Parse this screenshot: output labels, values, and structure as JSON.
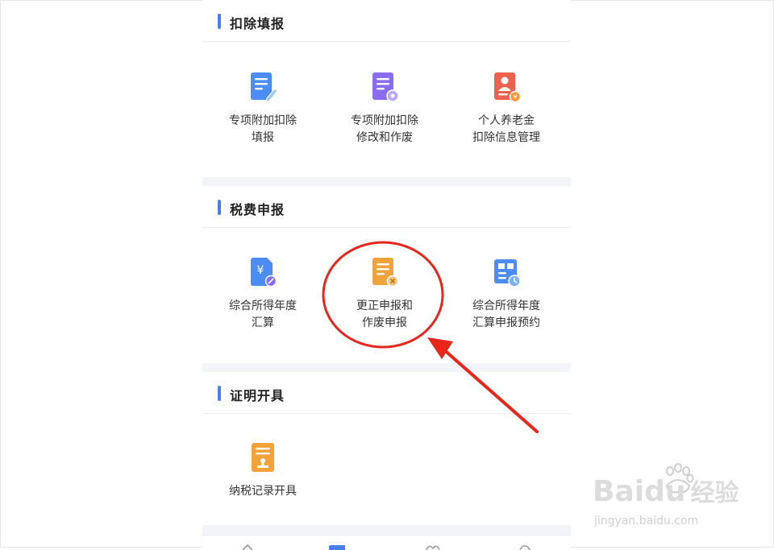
{
  "sections": [
    {
      "title": "扣除填报",
      "items": [
        {
          "line1": "专项附加扣除",
          "line2": "填报",
          "icon": "document-edit-icon",
          "color": "#4d8cf5"
        },
        {
          "line1": "专项附加扣除",
          "line2": "修改和作废",
          "icon": "document-settings-icon",
          "color": "#8a6cf0"
        },
        {
          "line1": "个人养老金",
          "line2": "扣除信息管理",
          "icon": "pension-card-icon",
          "color": "#f0604f"
        }
      ]
    },
    {
      "title": "税费申报",
      "items": [
        {
          "line1": "综合所得年度",
          "line2": "汇算",
          "icon": "tax-yuan-document-icon",
          "color": "#4d8cf5"
        },
        {
          "line1": "更正申报和",
          "line2": "作废申报",
          "icon": "document-void-icon",
          "color": "#f2a23a"
        },
        {
          "line1": "综合所得年度",
          "line2": "汇算申报预约",
          "icon": "appointment-clock-icon",
          "color": "#4d8cf5"
        }
      ]
    },
    {
      "title": "证明开具",
      "items": [
        {
          "line1": "纳税记录开具",
          "line2": "",
          "icon": "tax-record-stamp-icon",
          "color": "#f2a23a"
        }
      ]
    }
  ],
  "watermark": {
    "brand_text": "Bai",
    "brand_text2": "du",
    "suffix": "经验",
    "url": "jingyan.baidu.com"
  },
  "colors": {
    "accent": "#4c7ef3",
    "annotation_red": "#e8261c"
  }
}
